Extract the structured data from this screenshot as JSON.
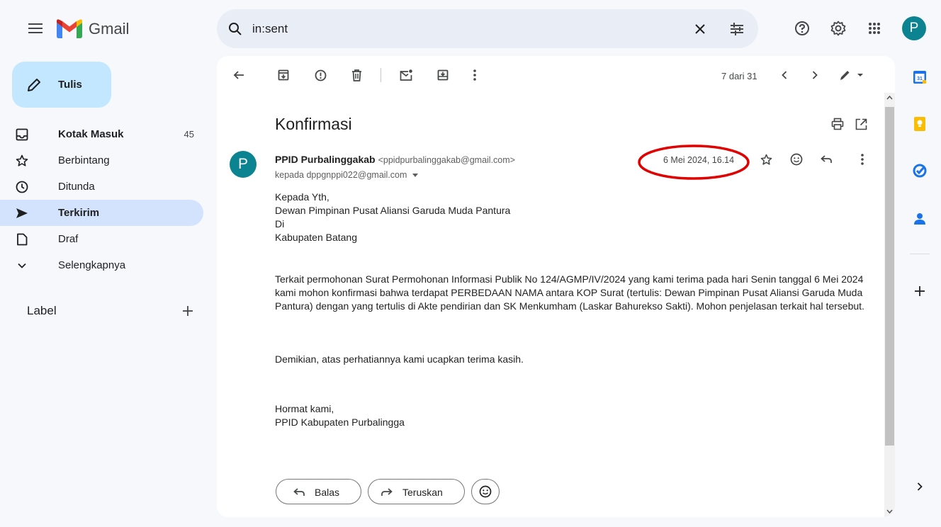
{
  "app": {
    "name": "Gmail"
  },
  "search": {
    "query": "in:sent"
  },
  "account": {
    "initial": "P"
  },
  "sidebar": {
    "compose_label": "Tulis",
    "items": [
      {
        "label": "Kotak Masuk",
        "count": "45",
        "bold": true,
        "icon": "inbox-icon"
      },
      {
        "label": "Berbintang",
        "count": "",
        "icon": "star-icon"
      },
      {
        "label": "Ditunda",
        "count": "",
        "icon": "clock-icon"
      },
      {
        "label": "Terkirim",
        "count": "",
        "bold": true,
        "active": true,
        "icon": "send-icon"
      },
      {
        "label": "Draf",
        "count": "",
        "icon": "draft-icon"
      },
      {
        "label": "Selengkapnya",
        "count": "",
        "icon": "chevron-down-icon"
      }
    ],
    "labels_heading": "Label"
  },
  "toolbar": {
    "pager": "7 dari 31"
  },
  "email": {
    "subject": "Konfirmasi",
    "sender_initial": "P",
    "sender_name": "PPID Purbalinggakab",
    "sender_email": "<ppidpurbalinggakab@gmail.com>",
    "to_line": "kepada dppgnppi022@gmail.com",
    "date": "6 Mei 2024, 16.14",
    "greeting": [
      "Kepada Yth,",
      "Dewan Pimpinan Pusat Aliansi Garuda Muda Pantura",
      "Di",
      "Kabupaten Batang"
    ],
    "paragraph1": "Terkait permohonan Surat Permohonan Informasi Publik No 124/AGMP/IV/2024 yang kami terima pada hari Senin tanggal 6 Mei 2024 kami mohon konfirmasi bahwa terdapat PERBEDAAN NAMA antara KOP Surat (tertulis: Dewan Pimpinan Pusat Aliansi Garuda Muda Pantura) dengan yang tertulis di Akte pendirian dan SK Menkumham (Laskar Bahurekso Sakti). Mohon penjelasan terkait hal tersebut.",
    "paragraph2": "Demikian, atas perhatiannya kami ucapkan terima kasih.",
    "closing": "Hormat kami,",
    "signature": "PPID Kabupaten Purbalingga"
  },
  "actions": {
    "reply_label": "Balas",
    "forward_label": "Teruskan"
  },
  "colors": {
    "accent": "#0b57d0",
    "highlight_circle": "#e00000",
    "avatar": "#0b8391"
  }
}
